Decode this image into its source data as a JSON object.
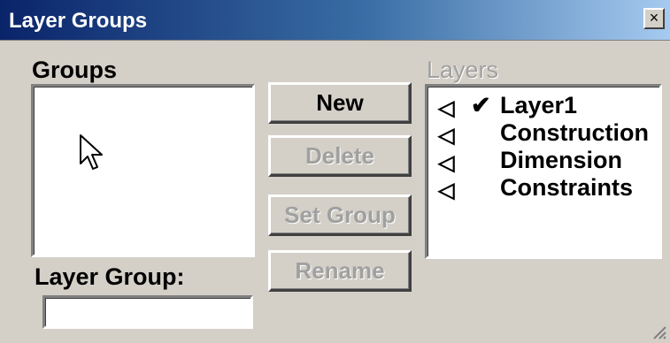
{
  "window": {
    "title": "Layer Groups",
    "close_glyph": "×"
  },
  "groups": {
    "label": "Groups",
    "items": []
  },
  "layers": {
    "label": "Layers",
    "items": [
      {
        "icon": "speaker-icon",
        "glyph": "◁",
        "current": true,
        "check": "✔",
        "name": "Layer1"
      },
      {
        "icon": "speaker-icon",
        "glyph": "◁",
        "current": false,
        "check": "",
        "name": "Construction"
      },
      {
        "icon": "speaker-icon",
        "glyph": "◁",
        "current": false,
        "check": "",
        "name": "Dimension"
      },
      {
        "icon": "speaker-icon",
        "glyph": "◁",
        "current": false,
        "check": "",
        "name": "Constraints"
      }
    ]
  },
  "buttons": {
    "new_label": "New",
    "delete_label": "Delete",
    "set_group_label": "Set Group",
    "rename_label": "Rename"
  },
  "layer_group": {
    "label": "Layer Group:",
    "value": ""
  }
}
